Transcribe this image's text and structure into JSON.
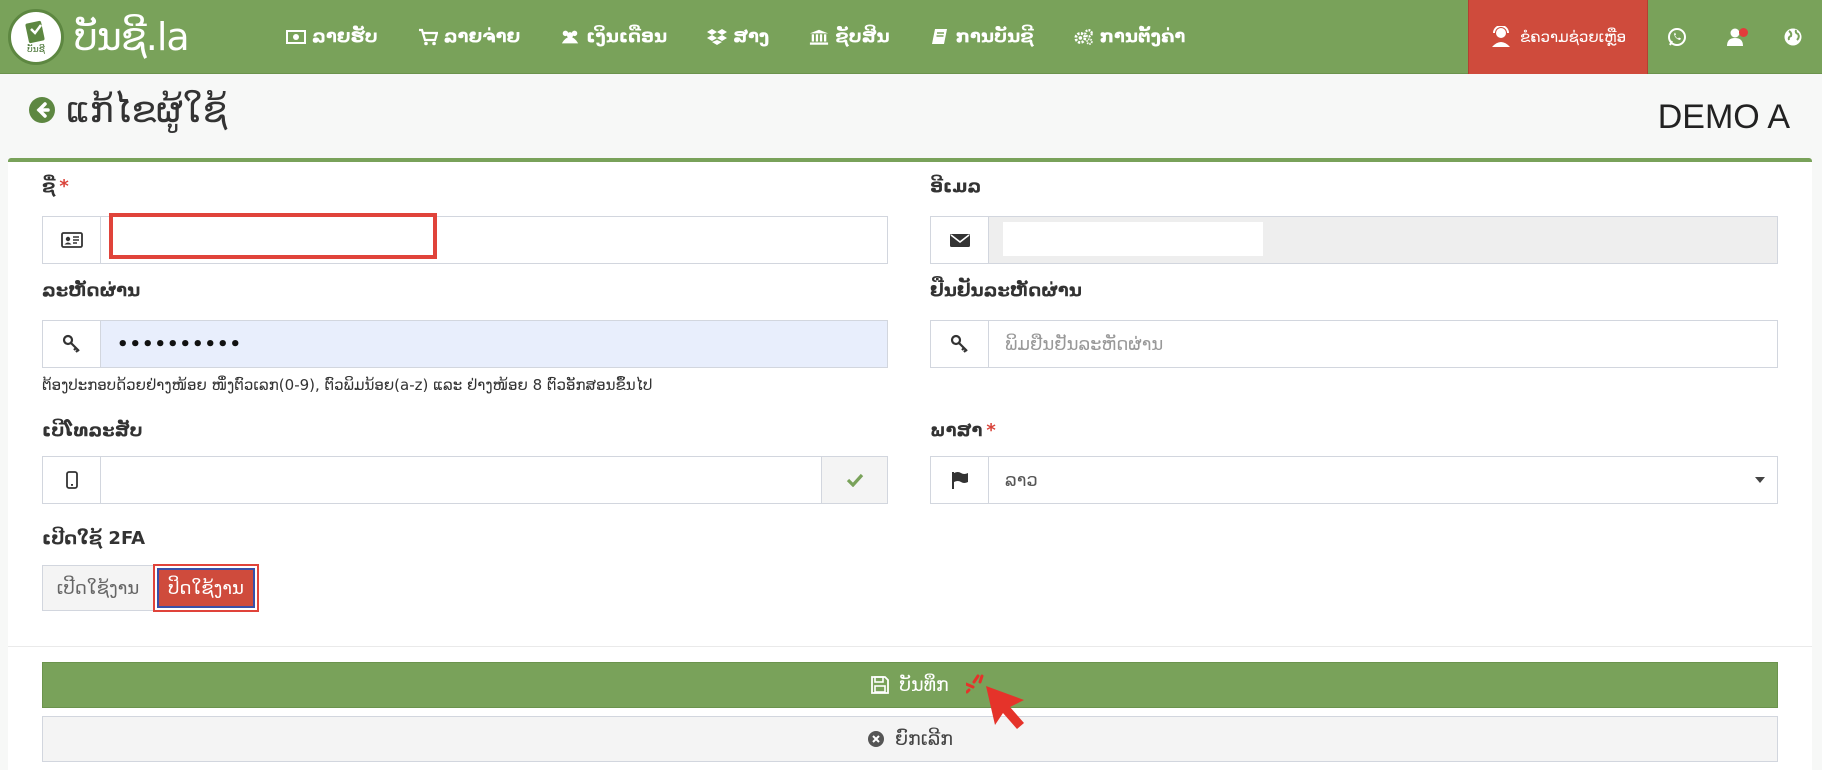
{
  "brand": {
    "name": "ບັນຊີ.la",
    "logo_text": "ບັນຊີ"
  },
  "nav": {
    "items": [
      {
        "label": "ລາຍຮັບ",
        "icon": "money-icon"
      },
      {
        "label": "ລາຍຈ່າຍ",
        "icon": "cart-icon"
      },
      {
        "label": "ເງິນເດືອນ",
        "icon": "users-icon"
      },
      {
        "label": "ສາງ",
        "icon": "dropbox-icon"
      },
      {
        "label": "ຊັບສິນ",
        "icon": "bank-icon"
      },
      {
        "label": "ການບັນຊີ",
        "icon": "book-icon"
      },
      {
        "label": "ການຕັ້ງຄ່າ",
        "icon": "cogs-icon"
      }
    ],
    "help_label": "ຂໍຄວາມຊ່ວຍເຫຼືອ"
  },
  "page": {
    "title": "ແກ້ໄຂຜູ້ໃຊ້",
    "company": "DEMO A"
  },
  "form": {
    "name": {
      "label": "ຊື່",
      "required_mark": "*",
      "value": ""
    },
    "email": {
      "label": "ອີເມລ",
      "value": ""
    },
    "password": {
      "label": "ລະຫັດຜ່ານ",
      "value": "••••••••••"
    },
    "password_help": "ຕ້ອງປະກອບດ້ວຍຢ່າງໜ້ອຍ ໜຶ່ງຕົວເລກ(0-9), ຕົວພິມນ້ອຍ(a-z) ແລະ ຢ່າງໜ້ອຍ 8 ຕົວອັກສອນຂຶ້ນໄປ",
    "confirm_password": {
      "label": "ຢືນຢັນລະຫັດຜ່ານ",
      "placeholder": "ພິມຢືນຢັນລະຫັດຜ່ານ"
    },
    "phone": {
      "label": "ເບີໂທລະສັບ",
      "value": ""
    },
    "language": {
      "label": "ພາສາ",
      "required_mark": "*",
      "value": "ລາວ"
    },
    "twofa": {
      "label": "ເປີດໃຊ້ 2FA",
      "off_label": "ເປີດໃຊ້ງານ",
      "on_label": "ປິດໃຊ້ງານ"
    },
    "save_label": "ບັນທຶກ",
    "cancel_label": "ຍົກເລີກ"
  },
  "colors": {
    "brand_green": "#79a25a",
    "danger_red": "#cf4b3c",
    "highlight_red": "#e0433a"
  }
}
